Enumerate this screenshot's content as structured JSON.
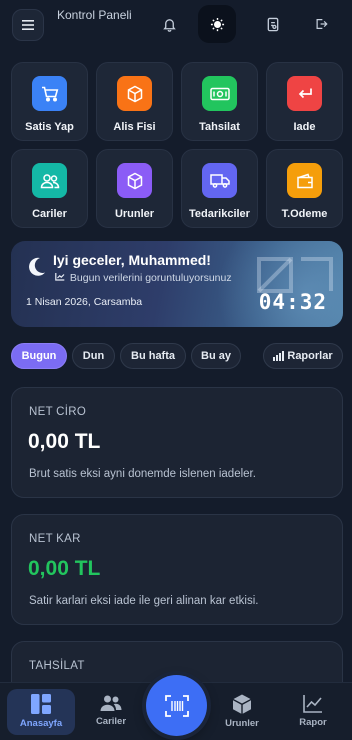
{
  "header": {
    "title": "Kontrol Paneli",
    "icons": [
      "menu-icon",
      "bell-icon",
      "sun-icon",
      "document-icon",
      "logout-icon"
    ]
  },
  "quick_actions": [
    {
      "label": "Satis Yap",
      "icon": "cart-icon",
      "color": "#3b82f6"
    },
    {
      "label": "Alis Fisi",
      "icon": "box-icon",
      "color": "#f97316"
    },
    {
      "label": "Tahsilat",
      "icon": "cash-icon",
      "color": "#22c55e"
    },
    {
      "label": "Iade",
      "icon": "return-icon",
      "color": "#ef4444"
    },
    {
      "label": "Cariler",
      "icon": "users-icon",
      "color": "#14b8a6"
    },
    {
      "label": "Urunler",
      "icon": "cube-icon",
      "color": "#8b5cf6"
    },
    {
      "label": "Tedarikciler",
      "icon": "truck-icon",
      "color": "#6366f1"
    },
    {
      "label": "T.Odeme",
      "icon": "wallet-icon",
      "color": "#f59e0b"
    }
  ],
  "banner": {
    "greeting": "Iyi geceler, Muhammed!",
    "subtitle": "Bugun verilerini goruntuluyorsunuz",
    "date": "1 Nisan 2026, Carsamba",
    "time": "04:32",
    "icon": "moon-icon"
  },
  "filters": {
    "chips": [
      "Bugun",
      "Dun",
      "Bu hafta",
      "Bu ay"
    ],
    "active": "Bugun",
    "report_label": "Raporlar"
  },
  "cards": [
    {
      "title": "NET CİRO",
      "value": "0,00 TL",
      "value_color": "#ffffff",
      "desc": "Brut satis eksi ayni donemde islenen iadeler."
    },
    {
      "title": "NET KAR",
      "value": "0,00 TL",
      "value_color": "#22c55e",
      "desc": "Satir karlari eksi iade ile geri alinan kar etkisi."
    },
    {
      "title": "TAHSİLAT"
    }
  ],
  "bottom_nav": [
    {
      "label": "Anasayfa",
      "icon": "dashboard-icon",
      "active": true
    },
    {
      "label": "Cariler",
      "icon": "users-icon",
      "active": false
    },
    {
      "label": "",
      "icon": "barcode-scan-icon",
      "active": false
    },
    {
      "label": "Urunler",
      "icon": "cube-icon",
      "active": false
    },
    {
      "label": "Rapor",
      "icon": "chart-line-icon",
      "active": false
    }
  ],
  "colors": {
    "background": "#141c2b",
    "accent": "#7b6cf3",
    "primary": "#3d6ef5"
  }
}
